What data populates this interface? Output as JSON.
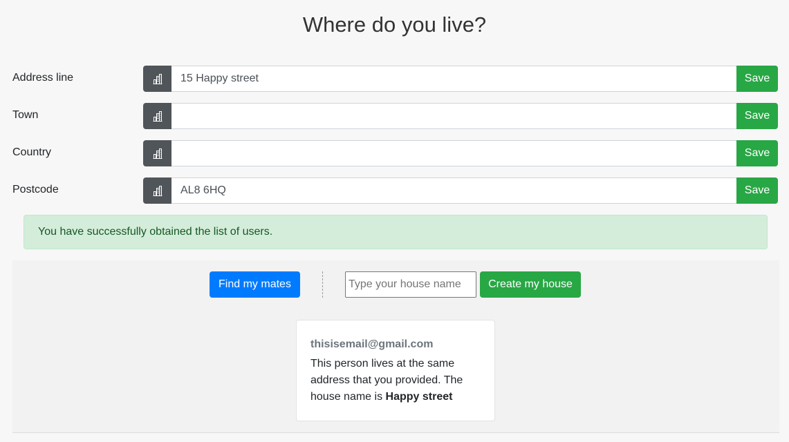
{
  "page": {
    "title": "Where do you live?"
  },
  "address_form": {
    "fields": [
      {
        "label": "Address line",
        "value": "15 Happy street",
        "icon": "building-icon",
        "save_label": "Save"
      },
      {
        "label": "Town",
        "value": "",
        "icon": "building-icon",
        "save_label": "Save"
      },
      {
        "label": "Country",
        "value": "",
        "icon": "building-icon",
        "save_label": "Save"
      },
      {
        "label": "Postcode",
        "value": "AL8 6HQ",
        "icon": "building-icon",
        "save_label": "Save"
      }
    ]
  },
  "alert": {
    "message": "You have successfully obtained the list of users."
  },
  "actions": {
    "find_mates_label": "Find my mates",
    "house_name_placeholder": "Type your house name",
    "create_house_label": "Create my house"
  },
  "mates": [
    {
      "email": "thisisemail@gmail.com",
      "text_before": "This person lives at the same address that you provided. The house name is ",
      "house_name": "Happy street"
    }
  ],
  "colors": {
    "success": "#28a745",
    "primary": "#007bff",
    "icon_addon": "#50555a",
    "alert_bg": "#d4edda",
    "alert_text": "#155724"
  }
}
